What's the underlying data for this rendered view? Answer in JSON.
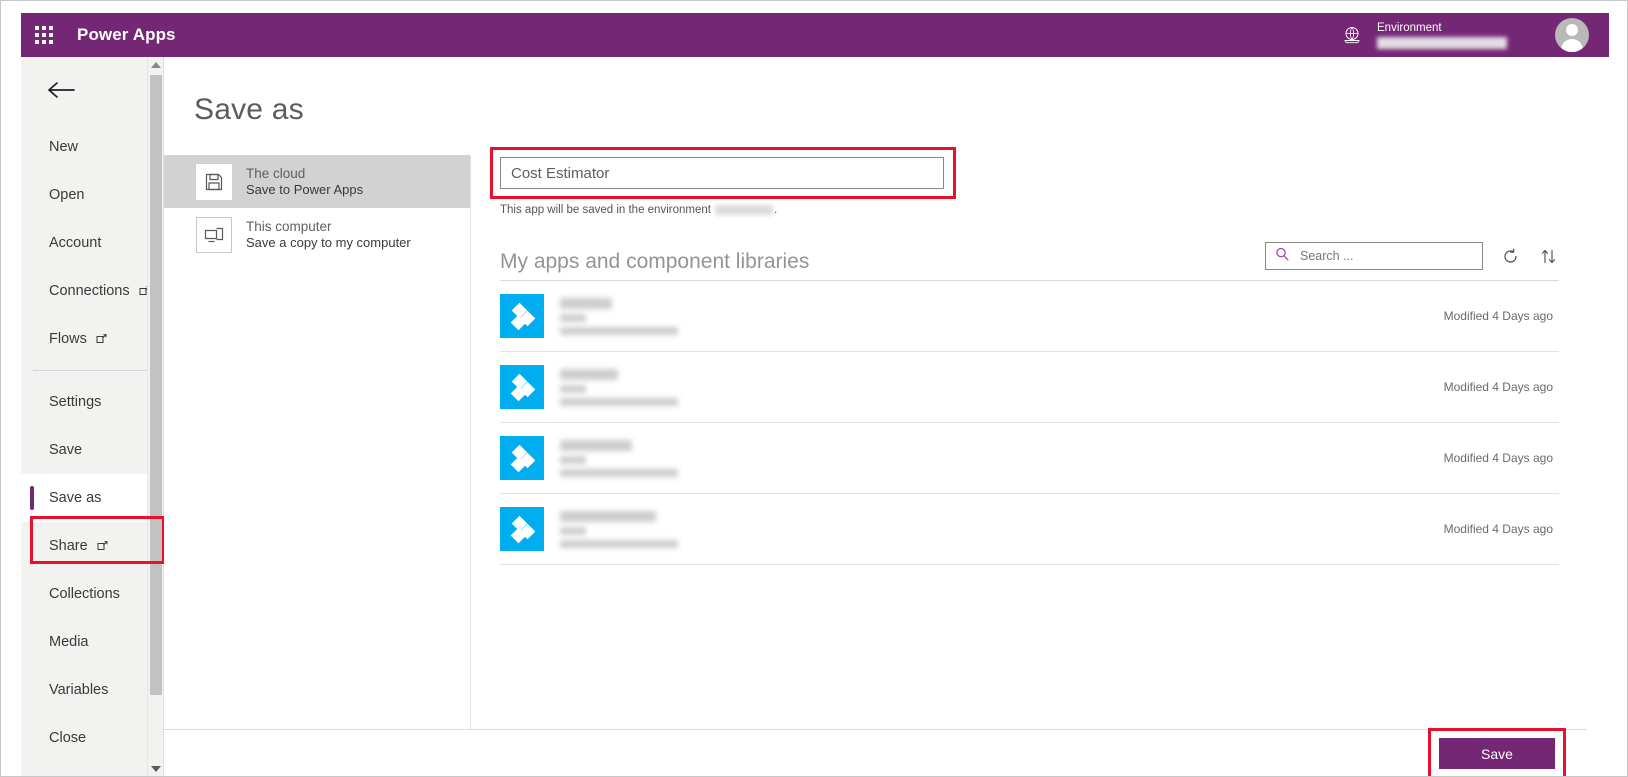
{
  "header": {
    "waffle_icon": "app-launcher-grid-icon",
    "brand": "Power Apps",
    "globe_icon": "globe-icon",
    "environment_label": "Environment",
    "environment_value": "",
    "avatar_icon": "user-avatar-icon"
  },
  "sidebar": {
    "back_icon": "back-arrow-icon",
    "items": [
      {
        "label": "New",
        "external": false,
        "selected": false
      },
      {
        "label": "Open",
        "external": false,
        "selected": false
      },
      {
        "label": "Account",
        "external": false,
        "selected": false
      },
      {
        "label": "Connections",
        "external": true,
        "selected": false
      },
      {
        "label": "Flows",
        "external": true,
        "selected": false
      },
      {
        "label": "Settings",
        "external": false,
        "selected": false
      },
      {
        "label": "Save",
        "external": false,
        "selected": false
      },
      {
        "label": "Save as",
        "external": false,
        "selected": true
      },
      {
        "label": "Share",
        "external": true,
        "selected": false
      },
      {
        "label": "Collections",
        "external": false,
        "selected": false
      },
      {
        "label": "Media",
        "external": false,
        "selected": false
      },
      {
        "label": "Variables",
        "external": false,
        "selected": false
      },
      {
        "label": "Close",
        "external": false,
        "selected": false
      }
    ],
    "scrollbar": {
      "up_icon": "scroll-up-arrow-icon",
      "down_icon": "scroll-down-arrow-icon"
    }
  },
  "main": {
    "page_title": "Save as",
    "destinations": [
      {
        "title": "The cloud",
        "subtitle": "Save to Power Apps",
        "icon": "floppy-disk-icon",
        "selected": true
      },
      {
        "title": "This computer",
        "subtitle": "Save a copy to my computer",
        "icon": "computer-monitor-icon",
        "selected": false
      }
    ],
    "app_name": {
      "value": "Cost Estimator",
      "placeholder": "App name"
    },
    "environment_hint_prefix": "This app will be saved in the environment",
    "environment_hint_suffix": ".",
    "apps_section": {
      "title": "My apps and component libraries",
      "search": {
        "placeholder": "Search ...",
        "value": "",
        "icon": "search-icon"
      },
      "refresh_icon": "refresh-icon",
      "sort_icon": "sort-arrows-icon",
      "rows": [
        {
          "icon": "power-apps-app-icon",
          "name": "",
          "modified": "Modified 4 Days ago"
        },
        {
          "icon": "power-apps-app-icon",
          "name": "",
          "modified": "Modified 4 Days ago"
        },
        {
          "icon": "power-apps-app-icon",
          "name": "",
          "modified": "Modified 4 Days ago"
        },
        {
          "icon": "power-apps-app-icon",
          "name": "",
          "modified": "Modified 4 Days ago"
        }
      ]
    },
    "save_button": "Save"
  },
  "annotations": {
    "color": "#e8112d",
    "targets": [
      "sidebar-save-as",
      "app-name-input",
      "save-button"
    ]
  },
  "colors": {
    "brand_purple": "#742774",
    "app_tile_blue": "#00aeef",
    "annotation_red": "#e8112d",
    "sidebar_bg": "#f2f2f1"
  }
}
